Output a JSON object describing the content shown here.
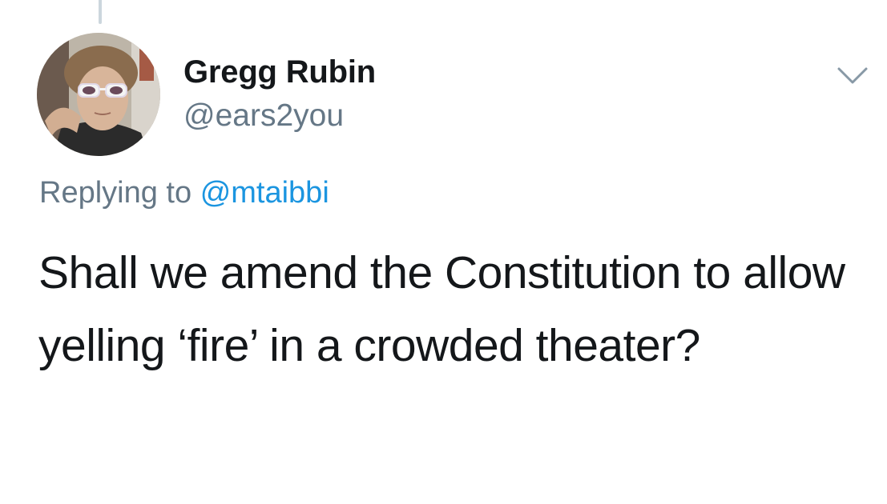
{
  "author": {
    "display_name": "Gregg Rubin",
    "handle": "@ears2you"
  },
  "reply": {
    "prefix": "Replying to",
    "mention": "@mtaibbi"
  },
  "tweet": {
    "text": "Shall we amend the Constitution to allow yelling ‘fire’ in a crowded theater?"
  },
  "icons": {
    "menu": "chevron-down-icon"
  },
  "colors": {
    "text_primary": "#14171a",
    "text_secondary": "#657786",
    "link": "#1b95e0",
    "thread_line": "#ccd6dd"
  }
}
